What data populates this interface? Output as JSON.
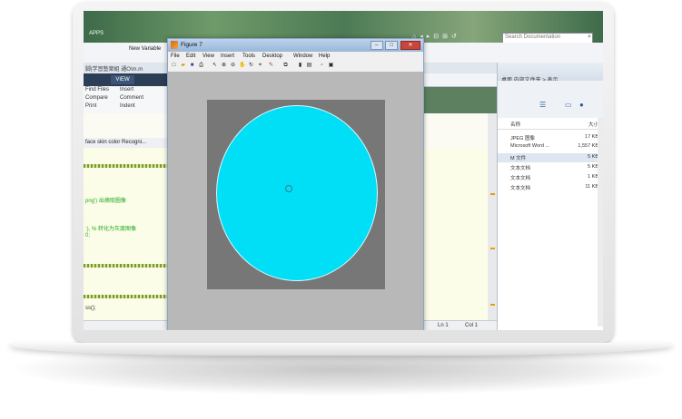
{
  "topbar": {
    "apps_tab": "APPS",
    "search_placeholder": "Search Documentation"
  },
  "ribbon": {
    "new_variable": "New Variable",
    "path_text": "脚|学習塾案組  通O\\m.m",
    "view_tab": "VIEW",
    "group_rows": [
      {
        "left": "Find Files",
        "right": "Insert"
      },
      {
        "left": "Compare",
        "right": "Comment"
      },
      {
        "left": "Print",
        "right": "Indent"
      }
    ]
  },
  "editor": {
    "tab_label": "face skin color Recogni...",
    "code_lines": [
      "png') 出摘取圖像",
      ":), % 转化为灰度图像",
      "0;",
      "ss();"
    ]
  },
  "status": {
    "ln_label": "Ln 1",
    "col_label": "Col 1"
  },
  "right_panel": {
    "path": "桌面 内部文件夹 > 表示",
    "columns": {
      "name": "名称",
      "size": "大小"
    },
    "files": [
      {
        "name": "JPEG 图像",
        "size": "17 KB"
      },
      {
        "name": "Microsoft Word ...",
        "size": "1,557 KB"
      },
      {
        "name": "M 文件",
        "size": "5 KB"
      },
      {
        "name": "文本文档",
        "size": "5 KB"
      },
      {
        "name": "文本文档",
        "size": "1 KB"
      },
      {
        "name": "文本文档",
        "size": "11 KB"
      }
    ]
  },
  "figure": {
    "title": "Figure 7",
    "menu": [
      "File",
      "Edit",
      "View",
      "Insert",
      "Tools",
      "Desktop",
      "Window",
      "Help"
    ],
    "circle_color": "#00dff5",
    "axes_background": "#777777",
    "figure_background": "#b8b8b8"
  }
}
